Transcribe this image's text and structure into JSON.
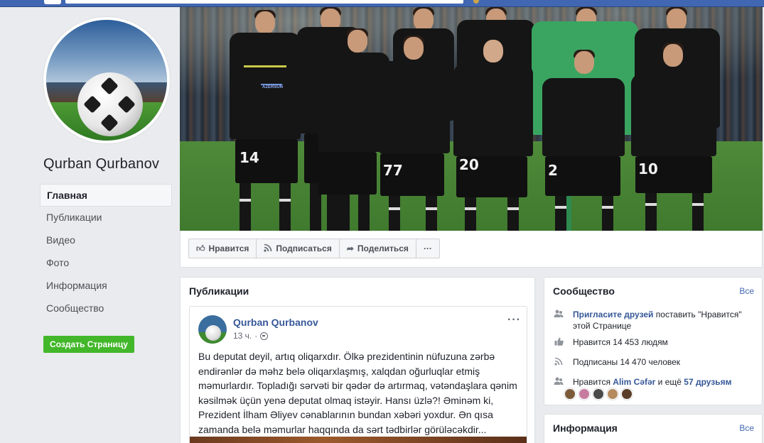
{
  "page": {
    "name": "Qurban Qurbanov"
  },
  "sidebar": {
    "items": [
      {
        "label": "Главная"
      },
      {
        "label": "Публикации"
      },
      {
        "label": "Видео"
      },
      {
        "label": "Фото"
      },
      {
        "label": "Информация"
      },
      {
        "label": "Сообщество"
      }
    ],
    "create_button": "Создать Страницу"
  },
  "cover": {
    "jersey_numbers": [
      "14",
      "77",
      "20",
      "2",
      "10"
    ],
    "sponsor": "AZERSUN"
  },
  "actions": {
    "like": "Нравится",
    "follow": "Подписаться",
    "share": "Поделиться",
    "more": "···"
  },
  "publications": {
    "title": "Публикации",
    "post": {
      "author": "Qurban Qurbanov",
      "time": "13 ч.",
      "more": "···",
      "text": "Bu deputat deyil, artıq oliqarxdır. Ölkə prezidentinin nüfuzuna zərbə endirənlər də məhz belə oliqarxlaşmış, xalqdan oğurluqlar etmiş məmurlardır. Topladığı sərvəti bir qədər də artırmaq, vətəndaşlara qənim kəsilmək üçün yenə deputat olmaq istəyir. Hansı üzlə?! Əminəm ki, Prezident İlham Əliyev cənablarının bundan xəbəri yoxdur. Ən qısa zamanda belə məmurlar haqqında da sərt tədbirlər görüləcəkdir..."
    }
  },
  "community": {
    "title": "Сообщество",
    "see_all": "Все",
    "invite_link": "Пригласите друзей",
    "invite_rest": " поставить \"Нравится\" этой Странице",
    "likes": "Нравится 14 453 людям",
    "followers": "Подписаны 14 470 человек",
    "friends_prefix": "Нравится ",
    "friends_name": "Alim Cəfər",
    "friends_mid": " и ещё ",
    "friends_more": "57 друзьям"
  },
  "info": {
    "title": "Информация",
    "see_all": "Все"
  },
  "colors": {
    "brand": "#4267b2",
    "link": "#365899",
    "create_button": "#42b72a"
  },
  "icons": {
    "like": "thumbs-up-icon",
    "follow": "rss-icon",
    "share": "share-arrow-icon",
    "invite": "people-icon",
    "privacy": "globe-icon"
  }
}
